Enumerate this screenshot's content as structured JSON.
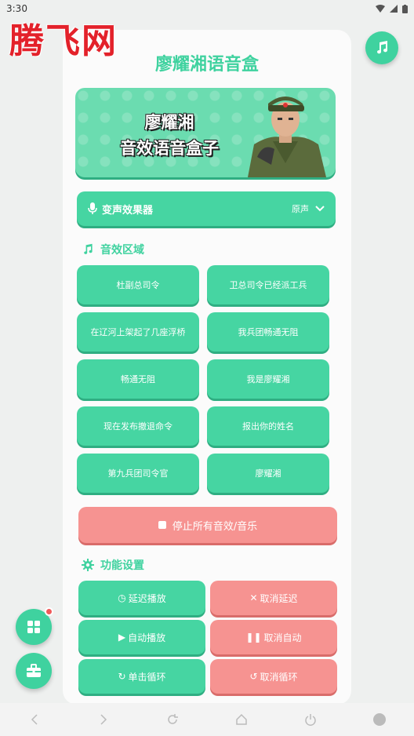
{
  "status_bar": {
    "time": "3:30"
  },
  "watermark": {
    "text": "腾飞网"
  },
  "header": {
    "title": "廖耀湘语音盒"
  },
  "banner": {
    "line1": "廖耀湘",
    "line2": "音效语音盒子"
  },
  "voice_changer": {
    "label": "变声效果器",
    "value": "原声"
  },
  "sound_section": {
    "title": "音效区域",
    "buttons": [
      "杜副总司令",
      "卫总司令已经派工兵",
      "在辽河上架起了几座浮桥",
      "我兵团畅通无阻",
      "畅通无阻",
      "我是廖耀湘",
      "现在发布撤退命令",
      "报出你的姓名",
      "第九兵团司令官",
      "廖耀湘"
    ]
  },
  "stop_button": {
    "label": "停止所有音效/音乐"
  },
  "function_section": {
    "title": "功能设置",
    "buttons": {
      "delay_play": "延迟播放",
      "cancel_delay": "取消延迟",
      "auto_play": "自动播放",
      "cancel_auto": "取消自动",
      "single_loop": "单击循环",
      "cancel_loop": "取消循环"
    }
  },
  "colors": {
    "primary": "#46d5a2",
    "danger": "#f69391",
    "title": "#3fd29f"
  }
}
